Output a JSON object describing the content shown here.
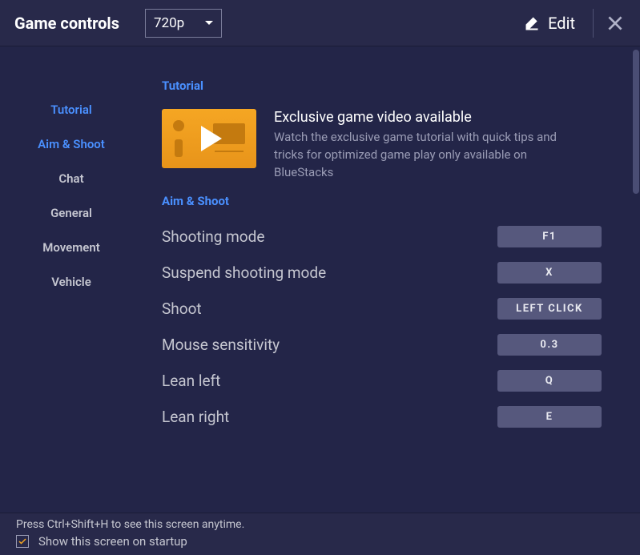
{
  "header": {
    "title": "Game controls",
    "resolution": "720p",
    "edit_label": "Edit"
  },
  "sidebar": {
    "items": [
      {
        "label": "Tutorial",
        "active": true
      },
      {
        "label": "Aim & Shoot",
        "active": true
      },
      {
        "label": "Chat",
        "active": false
      },
      {
        "label": "General",
        "active": false
      },
      {
        "label": "Movement",
        "active": false
      },
      {
        "label": "Vehicle",
        "active": false
      }
    ]
  },
  "content": {
    "tutorial": {
      "header": "Tutorial",
      "title": "Exclusive game video available",
      "desc": "Watch the exclusive game tutorial with quick tips and tricks for optimized game play only available on BlueStacks"
    },
    "aim_shoot": {
      "header": "Aim & Shoot",
      "bindings": [
        {
          "label": "Shooting mode",
          "key": "F1"
        },
        {
          "label": "Suspend shooting mode",
          "key": "X"
        },
        {
          "label": "Shoot",
          "key": "LEFT CLICK"
        },
        {
          "label": "Mouse sensitivity",
          "key": "0.3"
        },
        {
          "label": "Lean left",
          "key": "Q"
        },
        {
          "label": "Lean right",
          "key": "E"
        }
      ]
    }
  },
  "footer": {
    "hint": "Press Ctrl+Shift+H to see this screen anytime.",
    "checkbox_label": "Show this screen on startup",
    "checked": true
  }
}
